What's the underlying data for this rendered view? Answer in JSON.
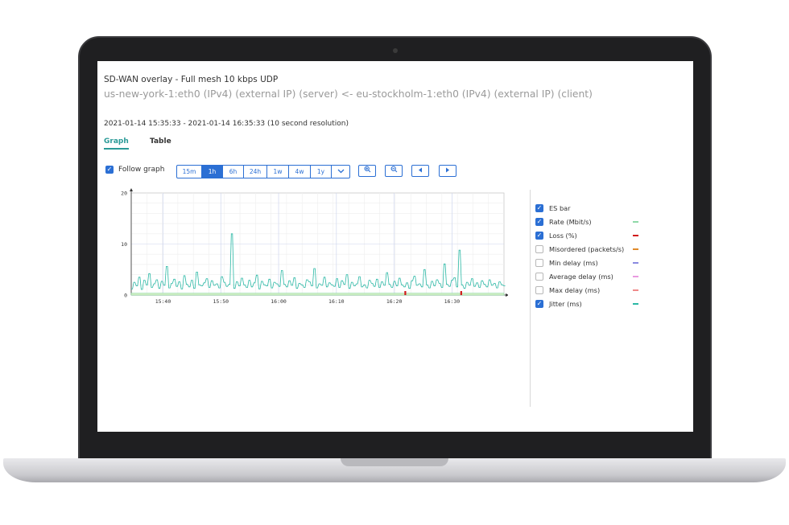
{
  "header": {
    "title": "SD-WAN overlay - Full mesh 10 kbps UDP",
    "subtitle": "us-new-york-1:eth0 (IPv4) (external IP) (server) <- eu-stockholm-1:eth0 (IPv4) (external IP) (client)",
    "time_range": "2021-01-14 15:35:33 - 2021-01-14 16:35:33 (10 second resolution)"
  },
  "tabs": [
    {
      "label": "Graph",
      "active": true
    },
    {
      "label": "Table",
      "active": false
    }
  ],
  "controls": {
    "follow_graph_label": "Follow graph",
    "follow_graph_checked": true,
    "ranges": [
      "15m",
      "1h",
      "6h",
      "24h",
      "1w",
      "4w",
      "1y"
    ],
    "active_range": "1h",
    "dropdown_icon": "chevron-down-icon",
    "zoom_in_icon": "zoom-in-icon",
    "zoom_out_icon": "zoom-out-icon",
    "prev_icon": "triangle-left-icon",
    "next_icon": "triangle-right-icon",
    "accent_color": "#2b6fd4"
  },
  "legend": [
    {
      "label": "ES bar",
      "checked": true,
      "color": ""
    },
    {
      "label": "Rate (Mbit/s)",
      "checked": true,
      "color": "#8fd9a8"
    },
    {
      "label": "Loss (%)",
      "checked": true,
      "color": "#d11a1a"
    },
    {
      "label": "Misordered (packets/s)",
      "checked": false,
      "color": "#e08a2a"
    },
    {
      "label": "Min delay (ms)",
      "checked": false,
      "color": "#8a8ae0"
    },
    {
      "label": "Average delay (ms)",
      "checked": false,
      "color": "#e99ae0"
    },
    {
      "label": "Max delay (ms)",
      "checked": false,
      "color": "#f08a8a"
    },
    {
      "label": "Jitter (ms)",
      "checked": true,
      "color": "#2ab8a5"
    }
  ],
  "chart_data": {
    "type": "line",
    "x_tick_labels": [
      "15:40",
      "15:50",
      "16:00",
      "16:10",
      "16:20",
      "16:30"
    ],
    "y_tick_labels": [
      "0",
      "10",
      "20"
    ],
    "ylim": [
      0,
      20
    ],
    "grid": true,
    "series": [
      {
        "name": "Jitter (ms)",
        "color": "#2ab8a5",
        "values": [
          1.2,
          2.5,
          1.8,
          3.5,
          1.1,
          2.9,
          2.0,
          4.2,
          1.5,
          2.2,
          3.0,
          1.3,
          2.7,
          1.9,
          5.6,
          1.4,
          2.3,
          3.1,
          1.7,
          2.6,
          1.2,
          3.8,
          2.1,
          1.6,
          2.9,
          1.3,
          4.5,
          2.0,
          1.8,
          2.4,
          3.2,
          1.5,
          2.8,
          1.9,
          2.2,
          1.4,
          3.6,
          2.5,
          1.7,
          2.1,
          12.0,
          1.3,
          2.6,
          1.8,
          3.3,
          2.0,
          1.5,
          2.9,
          1.6,
          2.4,
          3.9,
          1.2,
          2.7,
          2.0,
          1.8,
          3.1,
          1.4,
          2.5,
          2.2,
          1.7,
          4.8,
          2.1,
          1.6,
          2.8,
          1.9,
          3.4,
          1.3,
          2.3,
          2.0,
          1.5,
          3.0,
          2.6,
          1.8,
          5.2,
          1.4,
          2.2,
          1.9,
          3.5,
          1.6,
          2.4,
          2.0,
          1.7,
          3.2,
          1.5,
          2.8,
          2.1,
          4.0,
          1.3,
          2.5,
          1.8,
          2.2,
          3.6,
          1.6,
          2.0,
          1.4,
          2.9,
          2.3,
          1.7,
          3.1,
          1.5,
          2.6,
          1.9,
          4.4,
          2.1,
          1.5,
          2.7,
          1.8,
          3.3,
          2.0,
          1.6,
          2.4,
          1.3,
          2.8,
          3.7,
          1.9,
          2.2,
          1.6,
          5.0,
          2.0,
          1.4,
          2.7,
          1.8,
          3.0,
          2.3,
          1.5,
          6.1,
          2.1,
          1.7,
          2.9,
          3.4,
          1.6,
          8.8,
          2.0,
          1.3,
          2.5,
          1.9,
          3.2,
          1.7,
          2.4,
          1.5,
          2.8,
          2.1,
          1.6,
          3.0,
          1.9,
          2.3,
          1.4,
          2.6,
          2.0,
          1.8
        ]
      },
      {
        "name": "Rate (Mbit/s)",
        "color": "#8fd9a8",
        "values": [
          0.35,
          0.35,
          0.35,
          0.35,
          0.35,
          0.35,
          0.35,
          0.35,
          0.35,
          0.35,
          0.35,
          0.35,
          0.35,
          0.35,
          0.35,
          0.35,
          0.35,
          0.35,
          0.35,
          0.35
        ]
      }
    ],
    "loss_markers_x_fraction": [
      0.735,
      0.885
    ]
  }
}
